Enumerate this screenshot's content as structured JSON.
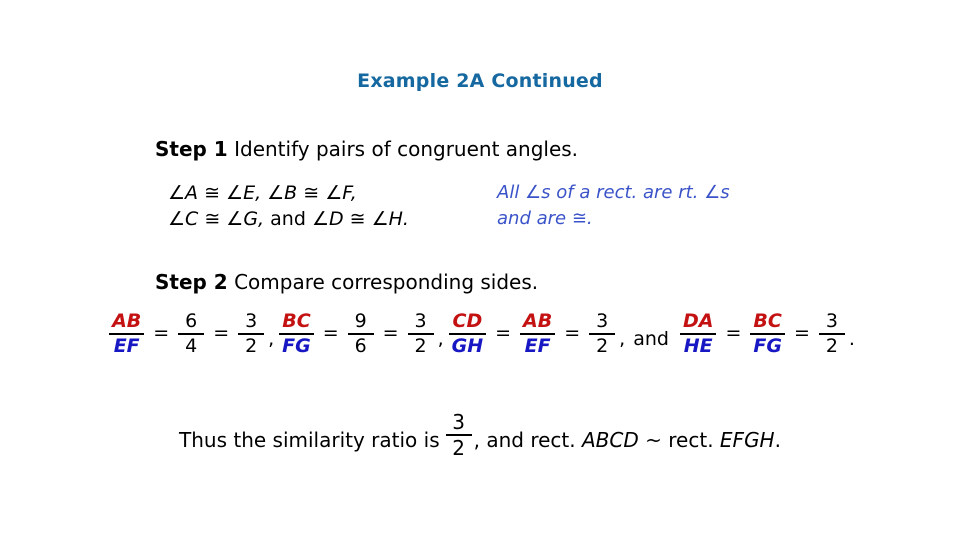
{
  "slide": {
    "title": "Example 2A Continued",
    "title_color": "#1668A0",
    "background_color": "#ffffff"
  },
  "colors": {
    "numerator_red": "#C41111",
    "denominator_blue": "#1717C4",
    "reason_blue": "#3A53C8",
    "text_black": "#000000"
  },
  "step1": {
    "label": "Step 1",
    "text": "Identify pairs of congruent angles.",
    "statement_line1": "∠A ≅ ∠E, ∠B ≅ ∠F,",
    "statement_line2_a": "∠C ≅ ∠G,",
    "statement_line2_and": "and",
    "statement_line2_b": "∠D ≅ ∠H.",
    "reason_line1": "All ∠s of a rect. are rt. ∠s",
    "reason_line2": "and are ≅."
  },
  "step2": {
    "label": "Step 2",
    "text": "Compare corresponding sides.",
    "proportions": [
      {
        "terms": [
          {
            "type": "fraction_letters",
            "num": "AB",
            "den": "EF"
          },
          {
            "type": "fraction_number",
            "num": "6",
            "den": "4"
          },
          {
            "type": "fraction_number",
            "num": "3",
            "den": "2"
          }
        ],
        "separator": ","
      },
      {
        "terms": [
          {
            "type": "fraction_letters",
            "num": "BC",
            "den": "FG"
          },
          {
            "type": "fraction_number",
            "num": "9",
            "den": "6"
          },
          {
            "type": "fraction_number",
            "num": "3",
            "den": "2"
          }
        ],
        "separator": ","
      },
      {
        "terms": [
          {
            "type": "fraction_letters",
            "num": "CD",
            "den": "GH"
          },
          {
            "type": "fraction_letters",
            "num": "AB",
            "den": "EF"
          },
          {
            "type": "fraction_number",
            "num": "3",
            "den": "2"
          }
        ],
        "separator": ","
      },
      {
        "terms": [
          {
            "type": "fraction_letters",
            "num": "DA",
            "den": "HE"
          },
          {
            "type": "fraction_letters",
            "num": "BC",
            "den": "FG"
          },
          {
            "type": "fraction_number",
            "num": "3",
            "den": "2"
          }
        ],
        "separator": "."
      }
    ],
    "conjunction": "and",
    "equals_sign": "="
  },
  "conclusion": {
    "lead": "Thus the similarity ratio is",
    "ratio_num": "3",
    "ratio_den": "2",
    "comma": ",",
    "middle": "and rect.",
    "shape1": "ABCD",
    "similar_symbol": "~",
    "middle2": "rect.",
    "shape2": "EFGH",
    "period": "."
  }
}
